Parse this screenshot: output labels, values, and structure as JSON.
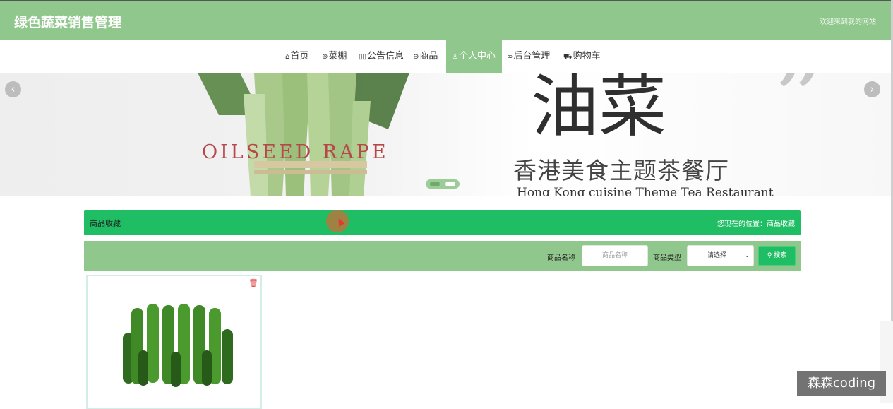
{
  "header": {
    "site_title": "绿色蔬菜销售管理",
    "welcome": "欢迎来到我的网站"
  },
  "nav": {
    "items": [
      {
        "icon": "home-icon",
        "label": "首页"
      },
      {
        "icon": "greenhouse-icon",
        "label": "菜棚"
      },
      {
        "icon": "notice-icon",
        "label": "公告信息"
      },
      {
        "icon": "goods-icon",
        "label": "商品"
      },
      {
        "icon": "user-icon",
        "label": "个人中心",
        "active": true
      },
      {
        "icon": "link-icon",
        "label": "后台管理"
      },
      {
        "icon": "cart-icon",
        "label": "购物车"
      }
    ]
  },
  "banner": {
    "english_text": "OILSEED RAPE",
    "title_big": "油菜",
    "chinese_text": "香港美食主题茶餐厅",
    "sub_text": "Hong Kong cuisine Theme Tea Restaurant",
    "slide_count": 2,
    "active_slide": 1
  },
  "breadcrumb": {
    "title": "商品收藏",
    "location": "您现在的位置：商品收藏"
  },
  "search": {
    "name_label": "商品名称",
    "name_placeholder": "商品名称",
    "type_label": "商品类型",
    "type_selected": "请选择",
    "search_button": "搜索"
  },
  "favorites": [
    {
      "image": "cucumbers",
      "delete_icon": "trash-icon"
    }
  ],
  "watermark": "森森coding",
  "colors": {
    "header_green": "#90c78c",
    "accent_green": "#1fbd64",
    "delete_red": "#e04848"
  }
}
